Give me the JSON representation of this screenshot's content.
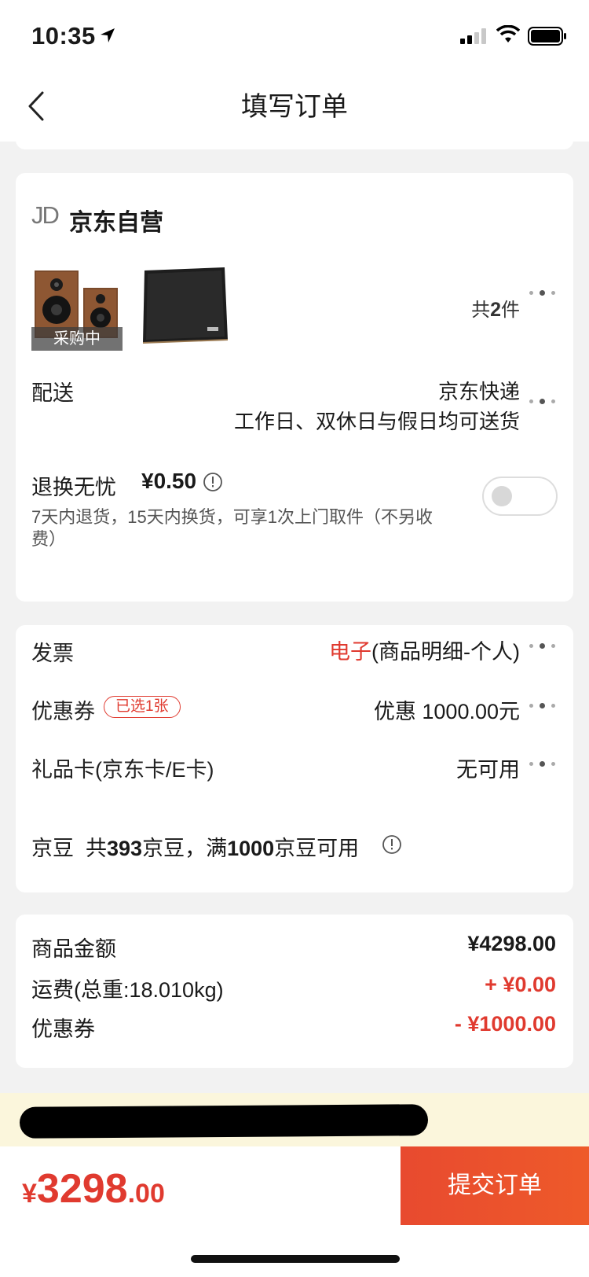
{
  "status_bar": {
    "time": "10:35"
  },
  "nav": {
    "title": "填写订单"
  },
  "store": {
    "logo": "JD",
    "name": "京东自营",
    "product_badge": "采购中",
    "count_prefix": "共",
    "count_value": "2",
    "count_suffix": "件"
  },
  "delivery": {
    "label": "配送",
    "method": "京东快递",
    "time": "工作日、双休日与假日均可送货"
  },
  "return_service": {
    "title": "退换无忧",
    "price": "¥0.50",
    "description": "7天内退货，15天内换货，可享1次上门取件（不另收费）",
    "enabled": false
  },
  "invoice": {
    "label": "发票",
    "type_highlight": "电子",
    "type_detail": "(商品明细-个人)"
  },
  "coupon": {
    "label": "优惠券",
    "badge": "已选1张",
    "value": "优惠 1000.00元"
  },
  "gift_card": {
    "label": "礼品卡(京东卡/E卡)",
    "value": "无可用"
  },
  "beans": {
    "label": "京豆",
    "text_1": "共",
    "count": "393",
    "text_2": "京豆，满",
    "threshold": "1000",
    "text_3": "京豆可用"
  },
  "summary": {
    "goods_label": "商品金额",
    "goods_value": "¥4298.00",
    "shipping_label": "运费(总重:18.010kg)",
    "shipping_value": "+ ¥0.00",
    "coupon_label": "优惠券",
    "coupon_value": "- ¥1000.00"
  },
  "footer": {
    "currency": "¥",
    "total_int": "3298",
    "total_dec": ".00",
    "submit_label": "提交订单"
  },
  "colors": {
    "accent": "#e03a2f",
    "notice_bg": "#fbf6dc"
  }
}
